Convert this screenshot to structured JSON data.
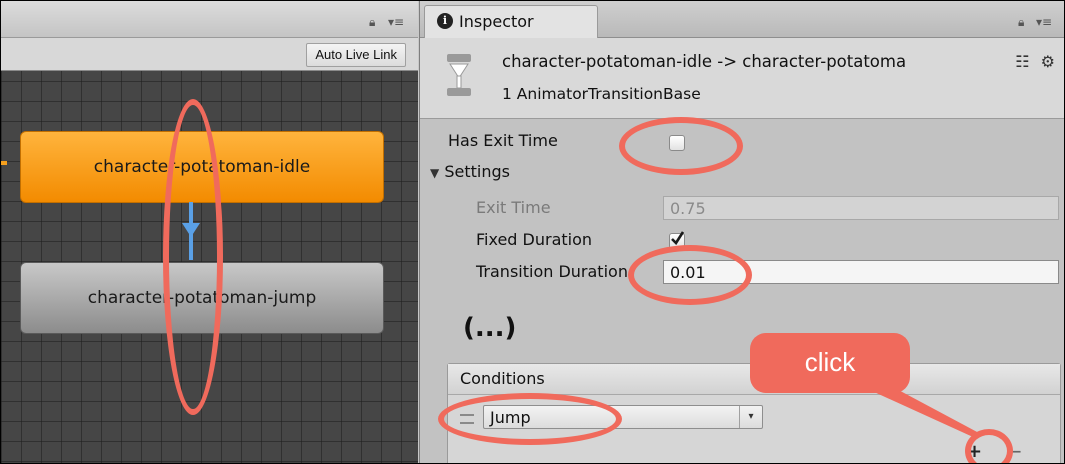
{
  "animator": {
    "auto_live_link_label": "Auto Live Link",
    "states": {
      "idle": "character-potatoman-idle",
      "jump": "character-potatoman-jump"
    }
  },
  "inspector": {
    "tab_label": "Inspector",
    "title": "character-potatoman-idle -> character-potatoma",
    "subtitle": "1 AnimatorTransitionBase",
    "has_exit_time_label": "Has Exit Time",
    "has_exit_time_checked": false,
    "settings_label": "Settings",
    "exit_time_label": "Exit Time",
    "exit_time_value": "0.75",
    "fixed_duration_label": "Fixed Duration",
    "fixed_duration_checked": true,
    "transition_duration_label": "Transition Duration",
    "transition_duration_value": "0.01",
    "ellipsis": "(...)",
    "conditions_label": "Conditions",
    "condition_param": "Jump",
    "add_label": "+",
    "remove_label": "−"
  },
  "annotation": {
    "click_label": "click",
    "color": "#f06a5c"
  },
  "icons": [
    "lock-icon",
    "menu-icon",
    "info-icon",
    "transition-icon",
    "preset-icon",
    "gear-icon",
    "dropdown-arrow-icon",
    "foldout-arrow-icon",
    "drag-handle-icon"
  ]
}
